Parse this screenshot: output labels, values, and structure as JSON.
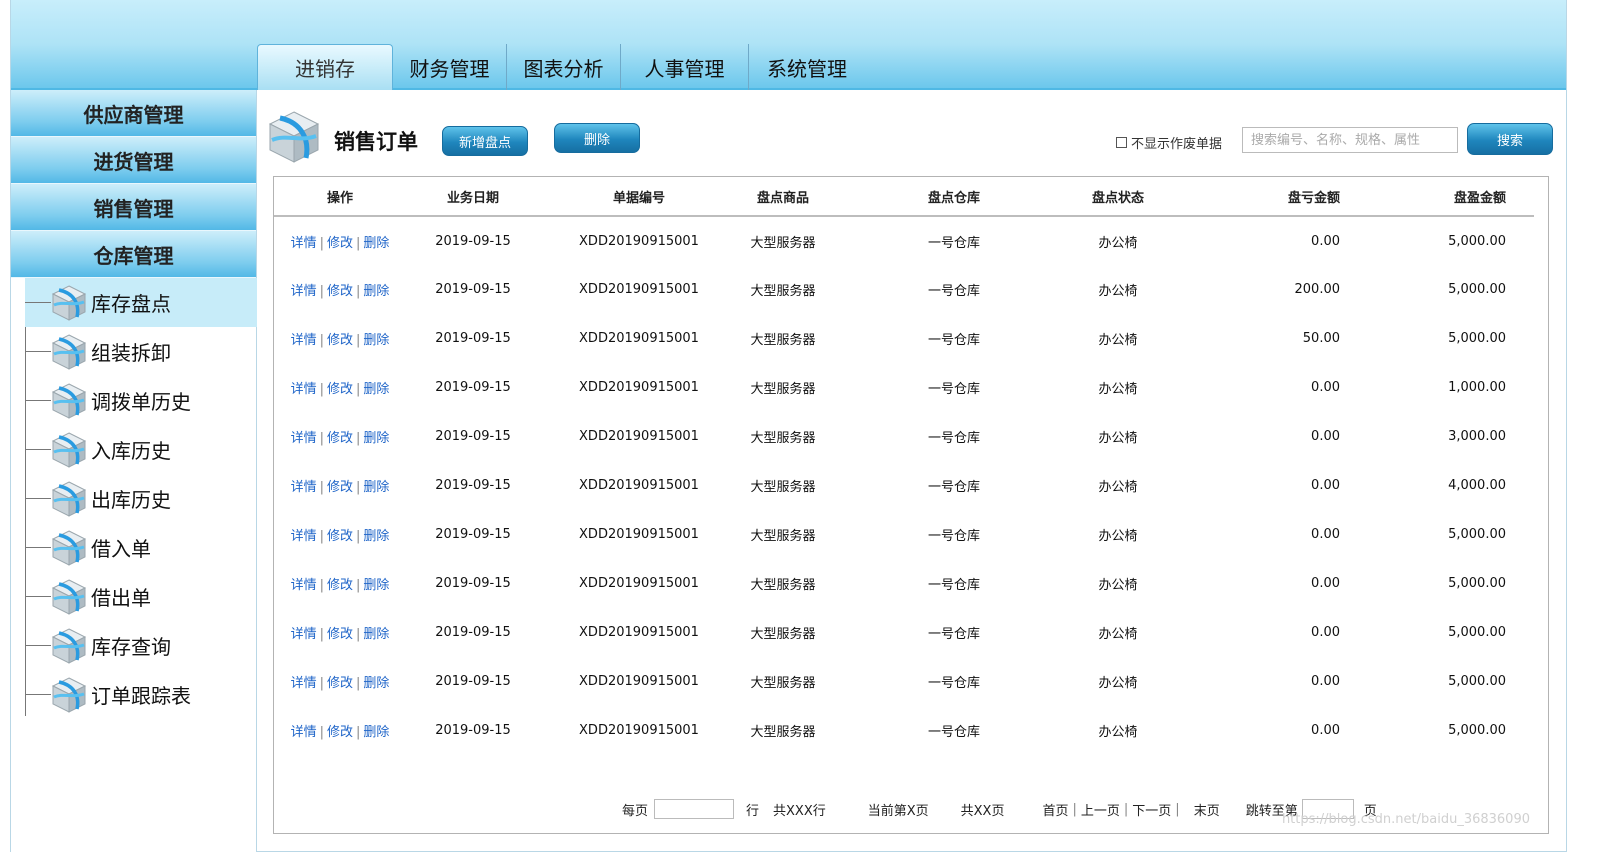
{
  "nav": {
    "tabs": [
      {
        "label": "进销存",
        "active": true
      },
      {
        "label": "财务管理"
      },
      {
        "label": "图表分析"
      },
      {
        "label": "人事管理"
      },
      {
        "label": "系统管理"
      }
    ]
  },
  "sidebar": {
    "categories": [
      "供应商管理",
      "进货管理",
      "销售管理",
      "仓库管理"
    ],
    "items": [
      "库存盘点",
      "组装拆卸",
      "调拨单历史",
      "入库历史",
      "出库历史",
      "借入单",
      "借出单",
      "库存查询",
      "订单跟踪表"
    ],
    "active_item": "库存盘点"
  },
  "toolbar": {
    "title": "销售订单",
    "add_label": "新增盘点",
    "delete_label": "删除",
    "checkbox_label": "不显示作废单据",
    "search_placeholder": "搜索编号、名称、规格、属性",
    "search_label": "搜索"
  },
  "table": {
    "headers": [
      "操作",
      "业务日期",
      "单据编号",
      "盘点商品",
      "盘点仓库",
      "盘点状态",
      "盘亏金额",
      "盘盈金额"
    ],
    "ops": {
      "detail": "详情",
      "edit": "修改",
      "delete": "删除"
    },
    "rows": [
      [
        "2019-09-15",
        "XDD20190915001",
        "大型服务器",
        "一号仓库",
        "办公椅",
        "0.00",
        "5,000.00"
      ],
      [
        "2019-09-15",
        "XDD20190915001",
        "大型服务器",
        "一号仓库",
        "办公椅",
        "200.00",
        "5,000.00"
      ],
      [
        "2019-09-15",
        "XDD20190915001",
        "大型服务器",
        "一号仓库",
        "办公椅",
        "50.00",
        "5,000.00"
      ],
      [
        "2019-09-15",
        "XDD20190915001",
        "大型服务器",
        "一号仓库",
        "办公椅",
        "0.00",
        "1,000.00"
      ],
      [
        "2019-09-15",
        "XDD20190915001",
        "大型服务器",
        "一号仓库",
        "办公椅",
        "0.00",
        "3,000.00"
      ],
      [
        "2019-09-15",
        "XDD20190915001",
        "大型服务器",
        "一号仓库",
        "办公椅",
        "0.00",
        "4,000.00"
      ],
      [
        "2019-09-15",
        "XDD20190915001",
        "大型服务器",
        "一号仓库",
        "办公椅",
        "0.00",
        "5,000.00"
      ],
      [
        "2019-09-15",
        "XDD20190915001",
        "大型服务器",
        "一号仓库",
        "办公椅",
        "0.00",
        "5,000.00"
      ],
      [
        "2019-09-15",
        "XDD20190915001",
        "大型服务器",
        "一号仓库",
        "办公椅",
        "0.00",
        "5,000.00"
      ],
      [
        "2019-09-15",
        "XDD20190915001",
        "大型服务器",
        "一号仓库",
        "办公椅",
        "0.00",
        "5,000.00"
      ],
      [
        "2019-09-15",
        "XDD20190915001",
        "大型服务器",
        "一号仓库",
        "办公椅",
        "0.00",
        "5,000.00"
      ]
    ]
  },
  "pager": {
    "per_page_label": "每页",
    "rows_unit": "行",
    "total_rows": "共XXX行",
    "current_page": "当前第X页",
    "total_pages": "共XX页",
    "first": "首页",
    "prev": "上一页",
    "next": "下一页",
    "last": "末页",
    "jump_label": "跳转至第",
    "page_unit": "页"
  },
  "watermark": "https://blog.csdn.net/baidu_36836090"
}
